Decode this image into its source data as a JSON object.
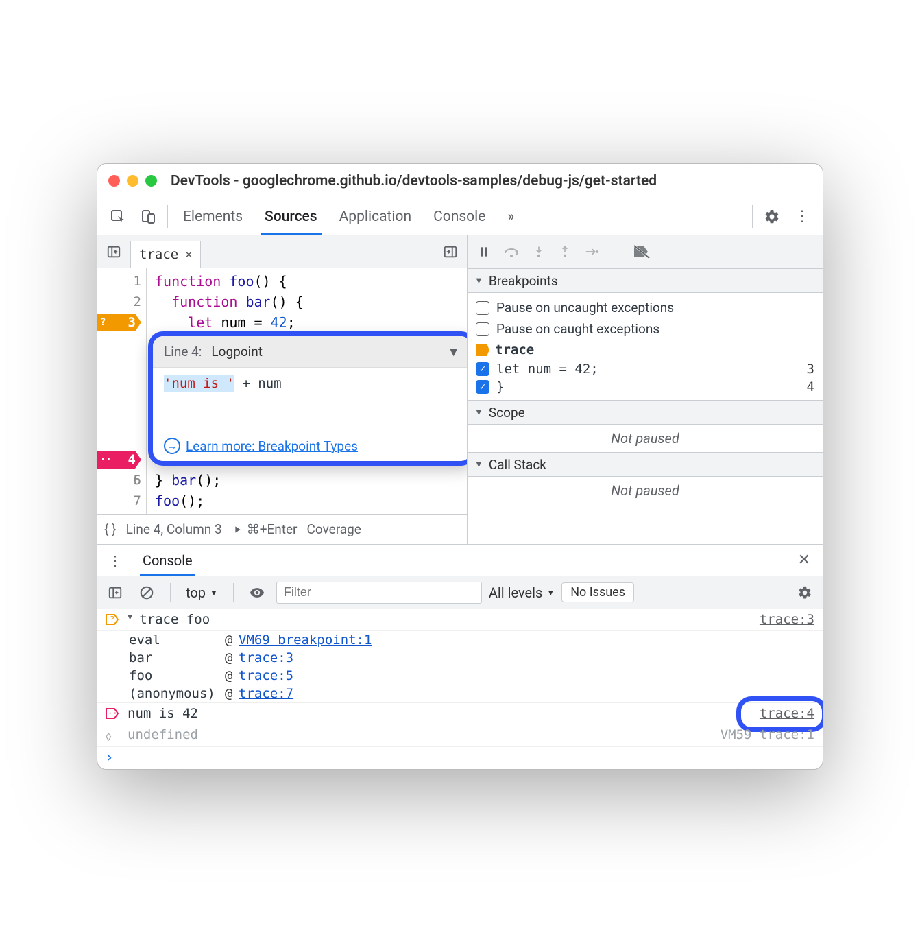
{
  "window": {
    "title": "DevTools - googlechrome.github.io/devtools-samples/debug-js/get-started"
  },
  "tabs": {
    "items": [
      "Elements",
      "Sources",
      "Application",
      "Console"
    ],
    "overflow": "»",
    "active": 1
  },
  "file_tab": {
    "name": "trace"
  },
  "code": {
    "lines": [
      {
        "n": 1,
        "raw": "function foo() {"
      },
      {
        "n": 2,
        "raw": "  function bar() {"
      },
      {
        "n": 3,
        "raw": "    let num = 42;",
        "bp": "orange",
        "badge": "?"
      },
      {
        "n": 4,
        "raw": "  }",
        "bp": "pink",
        "badge": "··"
      },
      {
        "n": 5,
        "raw": "  bar();"
      },
      {
        "n": 6,
        "raw": "}"
      },
      {
        "n": 7,
        "raw": "foo();"
      }
    ]
  },
  "popup": {
    "line_label": "Line 4:",
    "type_label": "Logpoint",
    "expr_str": "'num is '",
    "expr_rest": " + num",
    "learn_more": "Learn more: Breakpoint Types"
  },
  "statusbar": {
    "format_label": "{ }",
    "cursor": "Line 4, Column 3",
    "run_label": "⌘+Enter",
    "coverage": "Coverage"
  },
  "right": {
    "breakpoints": {
      "title": "Breakpoints",
      "uncaught": "Pause on uncaught exceptions",
      "caught": "Pause on caught exceptions",
      "group": "trace",
      "rows": [
        {
          "code": "let num = 42;",
          "line": "3",
          "checked": true
        },
        {
          "code": "}",
          "line": "4",
          "checked": true
        }
      ]
    },
    "scope": {
      "title": "Scope",
      "body": "Not paused"
    },
    "callstack": {
      "title": "Call Stack",
      "body": "Not paused"
    }
  },
  "drawer": {
    "tab": "Console",
    "context": "top",
    "filter_placeholder": "Filter",
    "levels": "All levels",
    "issues": "No Issues"
  },
  "console": {
    "rows": [
      {
        "kind": "trace-head",
        "text": "trace foo",
        "src": "trace:3"
      },
      {
        "kind": "stack",
        "fn": "eval",
        "loc": "VM69 breakpoint:1"
      },
      {
        "kind": "stack",
        "fn": "bar",
        "loc": "trace:3"
      },
      {
        "kind": "stack",
        "fn": "foo",
        "loc": "trace:5"
      },
      {
        "kind": "stack",
        "fn": "(anonymous)",
        "loc": "trace:7"
      },
      {
        "kind": "log",
        "text": "num is 42",
        "src": "trace:4",
        "highlight": true
      },
      {
        "kind": "return",
        "text": "undefined",
        "src": "VM59  trace:1"
      },
      {
        "kind": "prompt"
      }
    ]
  }
}
